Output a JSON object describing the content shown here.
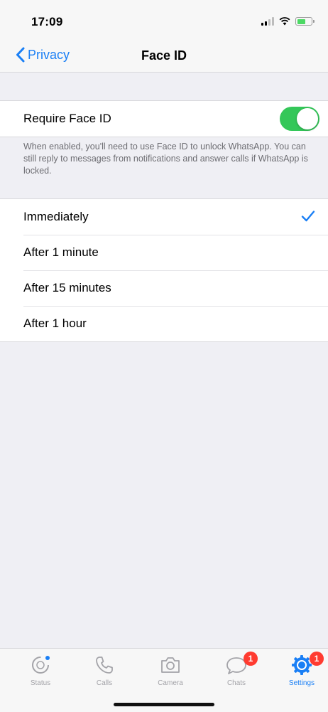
{
  "status_bar": {
    "time": "17:09"
  },
  "nav": {
    "back_label": "Privacy",
    "title": "Face ID"
  },
  "require": {
    "label": "Require Face ID",
    "enabled": true
  },
  "note": "When enabled, you'll need to use Face ID to unlock WhatsApp. You can still reply to messages from notifications and answer calls if WhatsApp is locked.",
  "options": [
    {
      "label": "Immediately",
      "selected": true
    },
    {
      "label": "After 1 minute",
      "selected": false
    },
    {
      "label": "After 15 minutes",
      "selected": false
    },
    {
      "label": "After 1 hour",
      "selected": false
    }
  ],
  "tabs": [
    {
      "label": "Status",
      "icon": "status-icon",
      "badge": ""
    },
    {
      "label": "Calls",
      "icon": "phone-icon",
      "badge": ""
    },
    {
      "label": "Camera",
      "icon": "camera-icon",
      "badge": ""
    },
    {
      "label": "Chats",
      "icon": "chat-bubble-icon",
      "badge": "1"
    },
    {
      "label": "Settings",
      "icon": "settings-gear-icon",
      "badge": "1"
    }
  ],
  "colors": {
    "accent": "#1a7ff5",
    "toggle_on": "#34c759",
    "badge": "#ff3b30"
  }
}
